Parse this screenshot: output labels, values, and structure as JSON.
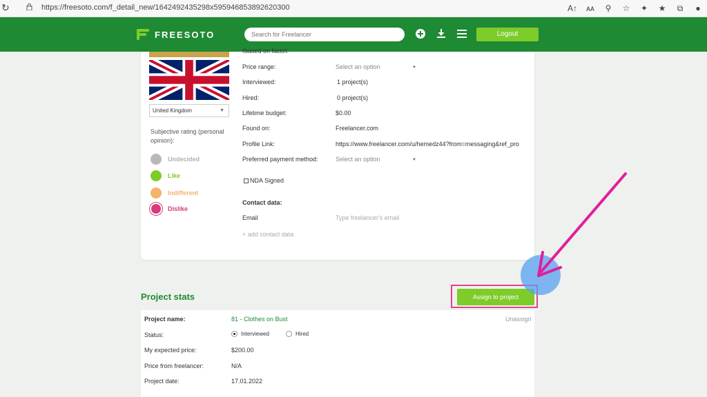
{
  "browser": {
    "url": "https://freesoto.com/f_detail_new/1642492435298x595946853892620300",
    "icons": [
      "read-aloud-icon",
      "translate-icon",
      "zoom-icon",
      "favorite-icon",
      "extensions-icon",
      "favorites-list-icon",
      "collections-icon",
      "profile-icon"
    ]
  },
  "nav": {
    "logo": "FREESOTO",
    "search_placeholder": "Search for Freelancer",
    "logout": "Logout",
    "icons": [
      "add-icon",
      "download-icon",
      "menu-icon"
    ],
    "color": "#1f8a34",
    "accent": "#7dcc2a"
  },
  "profile": {
    "country": "United Kingdom",
    "subjective_label": "Subjective rating (personal opinion):",
    "ratings": [
      {
        "label": "Undecided",
        "color": "#b9b9b9"
      },
      {
        "label": "Like",
        "color": "#7dcc2a"
      },
      {
        "label": "Indifferent",
        "color": "#f4b36b"
      },
      {
        "label": "Dislike",
        "color": "#d63b7a"
      }
    ],
    "selected_rating": "Dislike"
  },
  "details": {
    "cut_text": "(based on facts):",
    "price_range_label": "Price range:",
    "price_range_value": "Select an option",
    "interviewed_label": "Interviewed:",
    "interviewed_value": "1 project(s)",
    "hired_label": "Hired:",
    "hired_value": "0 project(s)",
    "lifetime_label": "Lifetime budget:",
    "lifetime_value": "$0.00",
    "found_label": "Found on:",
    "found_value": "Freelancer.com",
    "profile_link_label": "Profile Link:",
    "profile_link_value": "https://www.freelancer.com/u/hemedz44?from=messaging&ref_pro",
    "payment_label": "Preferred payment method:",
    "payment_value": "Select an option",
    "nda_label": "NDA Signed",
    "contact_label": "Contact data:",
    "email_label": "Email",
    "email_placeholder": "Type freelancer's email",
    "add_contact": "+ add contact data"
  },
  "stats": {
    "title": "Project stats",
    "assign_button": "Assign to project",
    "project_name_label": "Project name:",
    "project_name_value": "81 - Clothes on Bust",
    "unassign": "Unassign",
    "status_label": "Status:",
    "status_options": [
      "Interviewed",
      "Hired"
    ],
    "status_selected": "Interviewed",
    "expected_label": "My expected price:",
    "expected_value": "$200.00",
    "freelancer_price_label": "Price from freelancer:",
    "freelancer_price_value": "N/A",
    "date_label": "Project date:",
    "date_value": "17.01.2022"
  },
  "annotation": {
    "highlight_color": "#e83e8c",
    "cursor_color": "#58a0f0"
  }
}
